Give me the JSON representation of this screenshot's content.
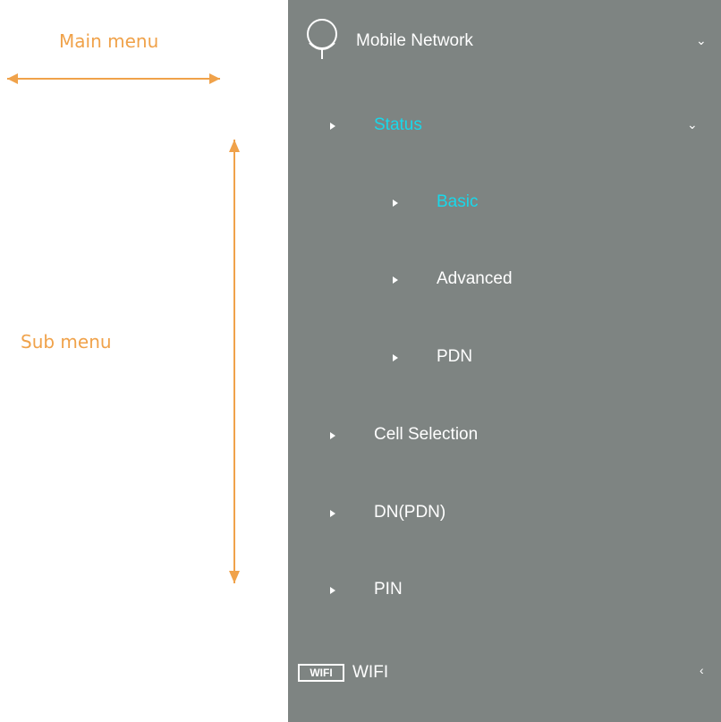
{
  "annotations": {
    "main_menu_label": "Main menu",
    "sub_menu_label": "Sub menu"
  },
  "sidebar": {
    "mobile_network": {
      "label": "Mobile Network",
      "icon": "globe-icon",
      "chevron": "chevron-down-icon"
    },
    "status": {
      "label": "Status",
      "chevron": "chevron-down-icon"
    },
    "status_items": [
      {
        "label": "Basic"
      },
      {
        "label": "Advanced"
      },
      {
        "label": "PDN"
      }
    ],
    "items": [
      {
        "label": "Cell Selection"
      },
      {
        "label": "DN(PDN)"
      },
      {
        "label": "PIN"
      }
    ],
    "wifi": {
      "label": "WIFI",
      "icon_text": "WIFI",
      "chevron": "chevron-left-icon"
    }
  },
  "colors": {
    "sidebar_bg": "#7e8482",
    "active": "#18d8ea",
    "annotation": "#f0a24a"
  }
}
